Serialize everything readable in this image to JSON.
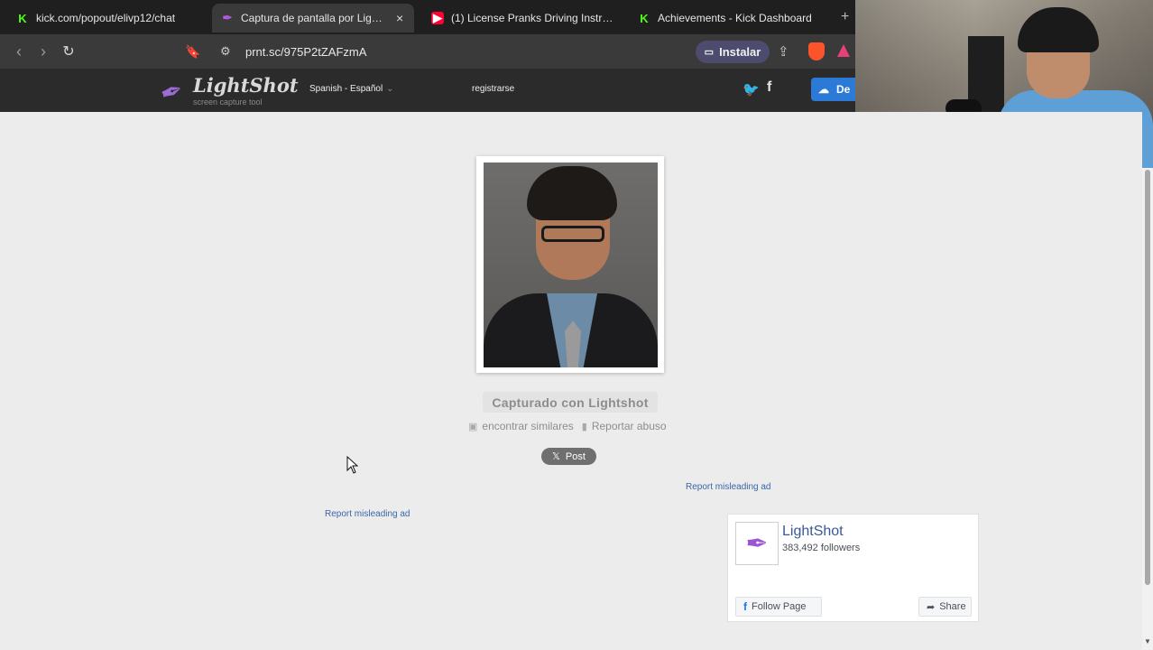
{
  "browser": {
    "tabs": [
      {
        "title": "kick.com/popout/elivp12/chat",
        "icon": "kick-icon"
      },
      {
        "title": "Captura de pantalla por Lightshot",
        "icon": "lightshot-feather-icon",
        "active": true
      },
      {
        "title": "(1) License Pranks Driving Instructor",
        "icon": "youtube-icon"
      },
      {
        "title": "Achievements - Kick Dashboard",
        "icon": "kick-icon"
      }
    ],
    "close_glyph": "×",
    "new_tab_glyph": "+",
    "url": "prnt.sc/975P2tZAFzmA",
    "install_label": "Instalar"
  },
  "site": {
    "logo_name": "LightShot",
    "logo_sub": "screen capture tool",
    "language": "Spanish - Español",
    "register": "registrarse",
    "download_label": "De"
  },
  "main": {
    "captured_label": "Capturado con Lightshot",
    "find_similar": "encontrar similares",
    "report_abuse": "Reportar abuso",
    "post_label": "Post",
    "report_ad_1": "Report misleading ad",
    "report_ad_2": "Report misleading ad"
  },
  "fb_widget": {
    "page_name": "LightShot",
    "followers": "383,492 followers",
    "follow_label": "Follow Page",
    "share_label": "Share"
  },
  "colors": {
    "accent": "#4d4c6e",
    "link": "#3b66a8",
    "kick": "#53fc18",
    "download": "#2b7bd6"
  }
}
